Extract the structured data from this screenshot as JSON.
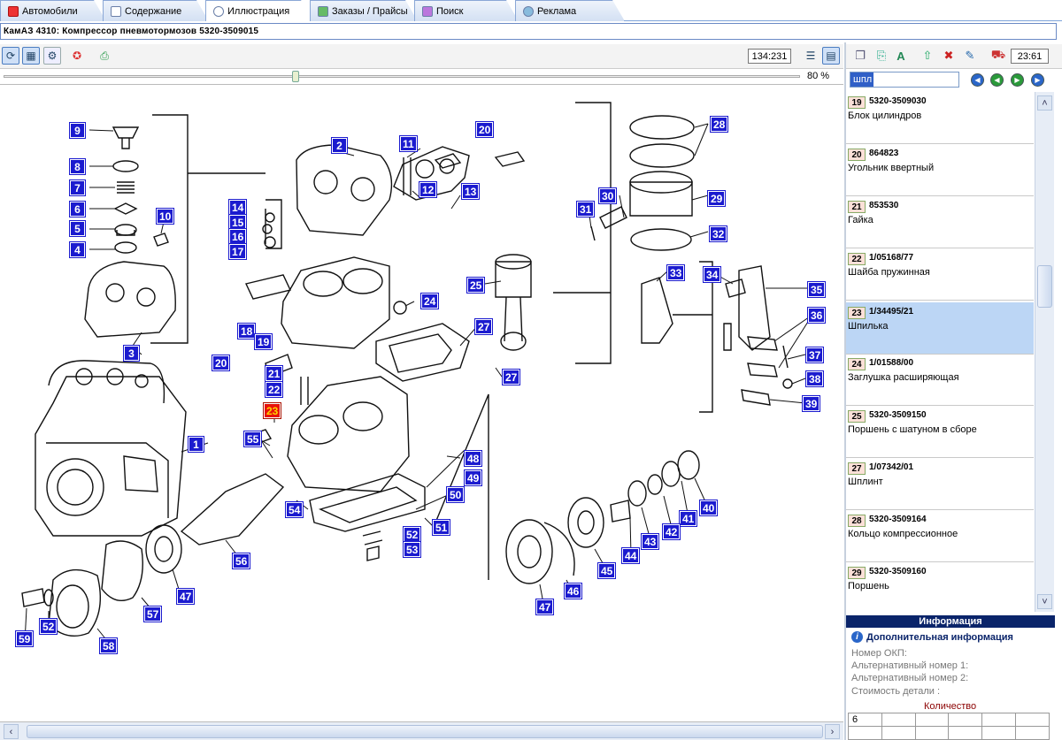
{
  "tabs": [
    {
      "label": "Автомобили",
      "icon": "car-icon"
    },
    {
      "label": "Содержание",
      "icon": "contents-icon"
    },
    {
      "label": "Иллюстрация",
      "icon": "illustration-icon",
      "active": true
    },
    {
      "label": "Заказы / Прайсы",
      "icon": "orders-icon"
    },
    {
      "label": "Поиск",
      "icon": "search-icon"
    },
    {
      "label": "Реклама",
      "icon": "globe-icon"
    }
  ],
  "title": "КамАЗ 4310: Компрессор пневмотормозов 5320-3509015",
  "viewer": {
    "coord": "134:231",
    "zoom_percent": "80 %",
    "zoom_level": 0.37,
    "tools": [
      "fit-icon",
      "grid-icon",
      "gear-icon",
      "star-icon",
      "print-icon"
    ],
    "view_tools": [
      "list-view-icon",
      "detail-view-icon"
    ]
  },
  "callouts": [
    "1",
    "2",
    "3",
    "4",
    "5",
    "6",
    "7",
    "8",
    "9",
    "10",
    "11",
    "12",
    "13",
    "14",
    "15",
    "16",
    "17",
    "18",
    "19",
    "20",
    "20",
    "21",
    "22",
    "23",
    "24",
    "25",
    "27",
    "27",
    "28",
    "29",
    "30",
    "31",
    "32",
    "33",
    "34",
    "35",
    "36",
    "37",
    "38",
    "39",
    "40",
    "41",
    "42",
    "43",
    "44",
    "45",
    "46",
    "47",
    "47",
    "48",
    "49",
    "50",
    "51",
    "52",
    "52",
    "53",
    "54",
    "55",
    "56",
    "57",
    "58",
    "59"
  ],
  "selected_callout": "23",
  "right": {
    "tools": [
      "copy-icon",
      "paste-icon",
      "text-icon",
      "up-icon",
      "delete-icon",
      "edit-icon",
      "cart-icon"
    ],
    "count": "23:61",
    "search_value": "шпл",
    "nav": [
      "first-icon",
      "prev-icon",
      "next-icon",
      "last-icon"
    ]
  },
  "parts": [
    {
      "num": "19",
      "code": "5320-3509030",
      "name": "Блок цилиндров"
    },
    {
      "num": "20",
      "code": "864823",
      "name": "Угольник ввертный"
    },
    {
      "num": "21",
      "code": "853530",
      "name": "Гайка"
    },
    {
      "num": "22",
      "code": "1/05168/77",
      "name": "Шайба пружинная"
    },
    {
      "num": "23",
      "code": "1/34495/21",
      "name": "Шпилька",
      "selected": true
    },
    {
      "num": "24",
      "code": "1/01588/00",
      "name": "Заглушка расширяющая"
    },
    {
      "num": "25",
      "code": "5320-3509150",
      "name": "Поршень с шатуном в сборе"
    },
    {
      "num": "27",
      "code": "1/07342/01",
      "name": "Шплинт"
    },
    {
      "num": "28",
      "code": "5320-3509164",
      "name": "Кольцо компрессионное"
    },
    {
      "num": "29",
      "code": "5320-3509160",
      "name": "Поршень"
    }
  ],
  "info": {
    "header": "Информация",
    "title": "Дополнительная информация",
    "fields": [
      "Номер ОКП:",
      "Альтернативный номер 1:",
      "Альтернативный номер 2:",
      "Стоимость детали :"
    ],
    "quantity_label": "Количество",
    "quantity_value": "6"
  },
  "colors": {
    "callout": "#1b1bcf",
    "callout_selected": "#e8120a",
    "selection": "#bcd6f5",
    "info_header": "#0a246a"
  }
}
